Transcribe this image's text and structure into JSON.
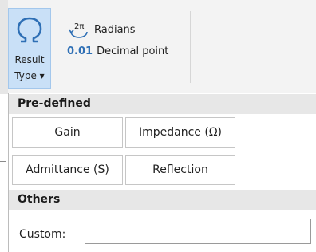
{
  "ribbon": {
    "result_type": {
      "line1": "Result",
      "line2": "Type ▾",
      "icon": "omega-icon"
    },
    "options": [
      {
        "icon": "two-pi-icon",
        "value": "",
        "label": "Radians"
      },
      {
        "icon": "",
        "value": "0.01",
        "label": "Decimal point"
      }
    ]
  },
  "dropdown": {
    "predefined_header": "Pre-defined",
    "buttons": [
      "Gain",
      "Impedance (Ω)",
      "Admittance (S)",
      "Reflection"
    ],
    "others_header": "Others",
    "custom_label": "Custom:",
    "custom_value": ""
  },
  "colors": {
    "accent": "#2e6fb5",
    "button_selected": "#c9e0f7",
    "header_bg": "#e7e7e7"
  }
}
